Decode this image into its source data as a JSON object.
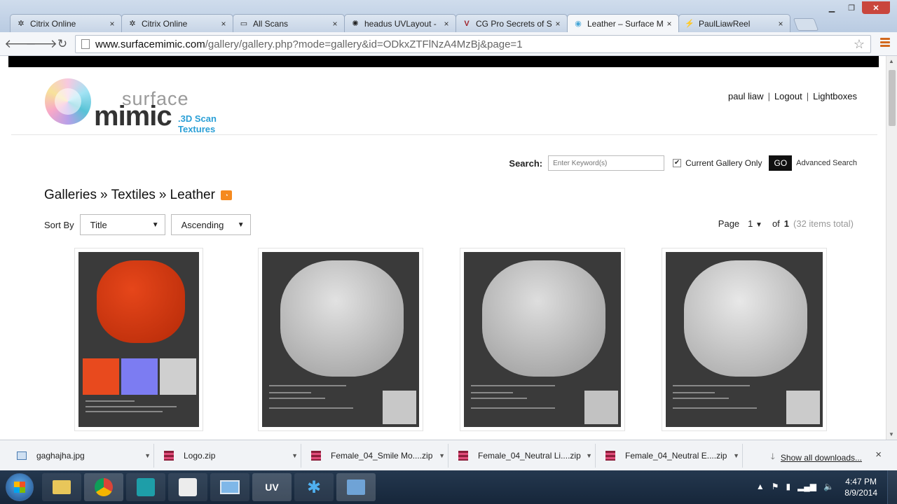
{
  "browser": {
    "tabs": [
      {
        "label": "Citrix Online",
        "icon": "citrix-icon",
        "active": false
      },
      {
        "label": "Citrix Online",
        "icon": "citrix-icon",
        "active": false
      },
      {
        "label": "All Scans",
        "icon": "page-icon",
        "active": false
      },
      {
        "label": "headus UVLayout -",
        "icon": "headus-icon",
        "active": false
      },
      {
        "label": "CG Pro Secrets of S",
        "icon": "cgpro-icon",
        "active": false
      },
      {
        "label": "Leather – Surface M",
        "icon": "surfacemimic-icon",
        "active": true
      },
      {
        "label": "PaulLiawReel",
        "icon": "bolt-icon",
        "active": false
      }
    ],
    "url_domain": "www.surfacemimic.com",
    "url_path": "/gallery/gallery.php?mode=gallery&id=ODkxZTFlNzA4MzBj&page=1"
  },
  "site": {
    "logo_surface": "surface",
    "logo_mimic": "mimic",
    "logo_tag": ".3D Scan Textures",
    "user": "paul liaw",
    "logout": "Logout",
    "lightboxes": "Lightboxes",
    "sep": "|"
  },
  "search": {
    "label": "Search:",
    "placeholder": "Enter Keyword(s)",
    "current_gallery": "Current Gallery Only",
    "current_gallery_checked": true,
    "go": "GO",
    "advanced": "Advanced Search"
  },
  "breadcrumb": {
    "galleries": "Galleries",
    "textiles": "Textiles",
    "leather": "Leather",
    "sep": "»"
  },
  "sort": {
    "label": "Sort By",
    "field": "Title",
    "order": "Ascending"
  },
  "pager": {
    "page_label": "Page",
    "page": "1",
    "of_label": "of",
    "pages": "1",
    "total": "(32 items total)"
  },
  "downloads": {
    "items": [
      {
        "name": "gaghajha.jpg",
        "icon": "image-file-icon"
      },
      {
        "name": "Logo.zip",
        "icon": "archive-icon"
      },
      {
        "name": "Female_04_Smile Mo....zip",
        "icon": "archive-icon"
      },
      {
        "name": "Female_04_Neutral Li....zip",
        "icon": "archive-icon"
      },
      {
        "name": "Female_04_Neutral E....zip",
        "icon": "archive-icon"
      }
    ],
    "show_all": "Show all downloads...",
    "close": "×"
  },
  "taskbar": {
    "time": "4:47 PM",
    "date": "8/9/2014",
    "apps": [
      "explorer-icon",
      "chrome-icon",
      "maya-icon",
      "zbrush-icon",
      "photo-viewer-icon",
      "uvlayout-icon",
      "snowflake-icon",
      "network-app-icon"
    ],
    "uv_label": "UV"
  }
}
